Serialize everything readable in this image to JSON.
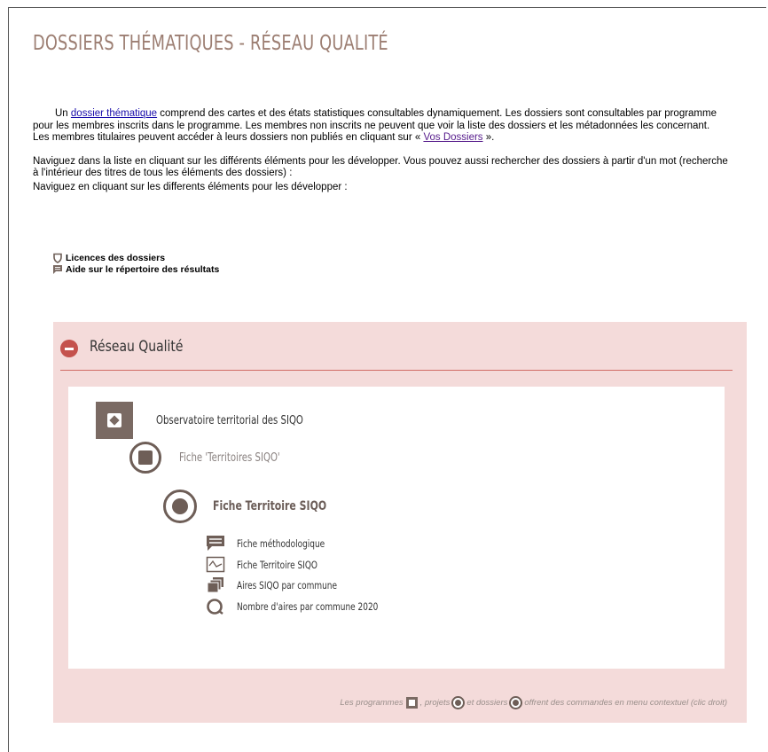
{
  "page": {
    "title": "DOSSIERS THÉMATIQUES - RÉSEAU QUALITÉ"
  },
  "intro": {
    "p1_before_link": "Un ",
    "p1_link": "dossier thématique",
    "p1_after_link": " comprend des cartes et des états statistiques consultables dynamiquement. Les dossiers sont consultables par programme pour les membres inscrits dans le programme. Les membres non inscrits ne peuvent que voir la liste des dossiers et les métadonnées les concernant.",
    "p2_before_link": "Les membres titulaires peuvent accéder à leurs dossiers non publiés en cliquant sur « ",
    "p2_link": "Vos Dossiers",
    "p2_after_link": " ».",
    "p3": "Naviguez dans la liste en cliquant sur les différents éléments pour les développer. Vous pouvez aussi rechercher des dossiers à partir d'un mot (recherche à l'intérieur des titres de tous les éléments des dossiers) :",
    "p4": "Naviguez en cliquant sur les differents éléments pour les développer :"
  },
  "links": {
    "licences": "Licences des dossiers",
    "aide": "Aide sur le répertoire des résultats"
  },
  "panel": {
    "title": "Réseau Qualité",
    "tree": {
      "program": "Observatoire territorial des SIQO",
      "project": "Fiche 'Territoires SIQO'",
      "dossier": "Fiche Territoire SIQO",
      "leaves": [
        {
          "label": "Fiche méthodologique",
          "icon": "comment-icon"
        },
        {
          "label": "Fiche Territoire SIQO",
          "icon": "chart-icon"
        },
        {
          "label": "Aires SIQO par commune",
          "icon": "layers-icon"
        },
        {
          "label": "Nombre d'aires par commune 2020",
          "icon": "circle-icon"
        }
      ]
    },
    "footer": {
      "t1": "Les programmes ",
      "t2": ", projets ",
      "t3": " et dossiers ",
      "t4": " offrent des commandes en menu contextuel (clic droit)"
    }
  },
  "colors": {
    "title": "#9c7e72",
    "panel_bg": "#f4dbda",
    "accent_red": "#c4524d",
    "icon_brown": "#6e5e57"
  }
}
